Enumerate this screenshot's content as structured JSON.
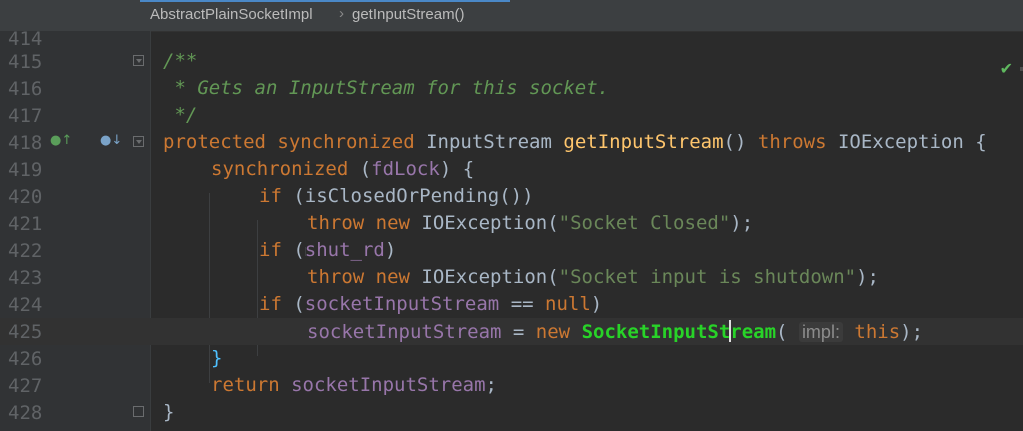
{
  "breadcrumb": {
    "class_name": "AbstractPlainSocketImpl",
    "method_name": "getInputStream()"
  },
  "status": {
    "inspection_ok_icon": "check-icon"
  },
  "gutter_icons": {
    "implements_icon": "implemented-method-icon",
    "overrides_icon": "override-method-icon"
  },
  "lines": [
    {
      "n": "414",
      "t": ""
    },
    {
      "n": "415",
      "t": "/**"
    },
    {
      "n": "416",
      "t": " * Gets an InputStream for this socket."
    },
    {
      "n": "417",
      "t": " */"
    },
    {
      "n": "418",
      "kw1": "protected synchronized ",
      "type": "InputStream ",
      "fn": "getInputStream",
      "paren": "() ",
      "kw2": "throws ",
      "type2": "IOException ",
      "brace": "{"
    },
    {
      "n": "419",
      "kw": "synchronized ",
      "open": "(",
      "fld": "fdLock",
      "close": ") ",
      "brace": "{"
    },
    {
      "n": "420",
      "kw": "if ",
      "rest": "(isClosedOrPending())"
    },
    {
      "n": "421",
      "kw": "throw new ",
      "type": "IOException(",
      "str": "\"Socket Closed\"",
      "end": ");"
    },
    {
      "n": "422",
      "kw": "if ",
      "open": "(",
      "fld": "shut_rd",
      "close": ")"
    },
    {
      "n": "423",
      "kw": "throw new ",
      "type": "IOException(",
      "str": "\"Socket input is shutdown\"",
      "end": ");"
    },
    {
      "n": "424",
      "kw": "if ",
      "open": "(",
      "fld": "socketInputStream",
      "mid": " == ",
      "kw2": "null",
      "close": ")"
    },
    {
      "n": "425",
      "fld": "socketInputStream",
      "mid": " = ",
      "kw": "new ",
      "ctor_a": "SocketInputSt",
      "ctor_b": "ream",
      "open": "( ",
      "hint": "impl:",
      "kw2": " this",
      "close": ");"
    },
    {
      "n": "426",
      "t": "}"
    },
    {
      "n": "427",
      "kw": "return ",
      "fld": "socketInputStream",
      "end": ";"
    },
    {
      "n": "428",
      "t": "}"
    }
  ]
}
